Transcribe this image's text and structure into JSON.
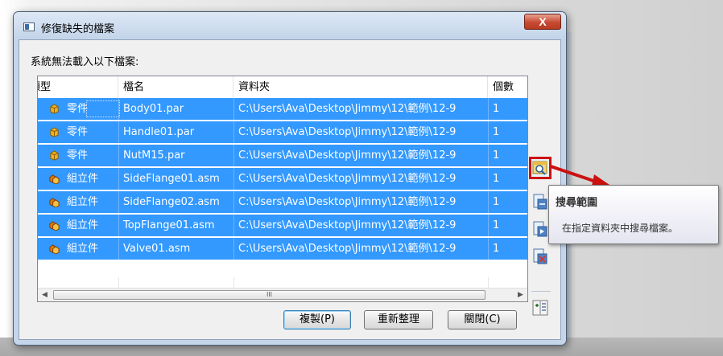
{
  "dialog": {
    "title": "修復缺失的檔案",
    "close_label": "X",
    "prompt": "系統無法載入以下檔案:"
  },
  "table": {
    "headers": [
      "類型",
      "檔名",
      "資料夾",
      "個數"
    ],
    "rows": [
      {
        "type": "零件",
        "type_icon": "part-icon",
        "name": "Body01.par",
        "folder": "C:\\Users\\Ava\\Desktop\\Jimmy\\12\\範例\\12-9",
        "count": "1"
      },
      {
        "type": "零件",
        "type_icon": "part-icon",
        "name": "Handle01.par",
        "folder": "C:\\Users\\Ava\\Desktop\\Jimmy\\12\\範例\\12-9",
        "count": "1"
      },
      {
        "type": "零件",
        "type_icon": "part-icon",
        "name": "NutM15.par",
        "folder": "C:\\Users\\Ava\\Desktop\\Jimmy\\12\\範例\\12-9",
        "count": "1"
      },
      {
        "type": "組立件",
        "type_icon": "assembly-icon",
        "name": "SideFlange01.asm",
        "folder": "C:\\Users\\Ava\\Desktop\\Jimmy\\12\\範例\\12-9",
        "count": "1"
      },
      {
        "type": "組立件",
        "type_icon": "assembly-icon",
        "name": "SideFlange02.asm",
        "folder": "C:\\Users\\Ava\\Desktop\\Jimmy\\12\\範例\\12-9",
        "count": "1"
      },
      {
        "type": "組立件",
        "type_icon": "assembly-icon",
        "name": "TopFlange01.asm",
        "folder": "C:\\Users\\Ava\\Desktop\\Jimmy\\12\\範例\\12-9",
        "count": "1"
      },
      {
        "type": "組立件",
        "type_icon": "assembly-icon",
        "name": "Valve01.asm",
        "folder": "C:\\Users\\Ava\\Desktop\\Jimmy\\12\\範例\\12-9",
        "count": "1"
      }
    ],
    "scroll_thumb_label": "III"
  },
  "buttons": {
    "copy": "複製(P)",
    "refresh": "重新整理",
    "close": "關閉(C)"
  },
  "toolbar": {
    "icons": [
      "search-scope-icon",
      "replace-file-icon",
      "browse-file-icon",
      "remove-file-icon",
      "column-settings-icon"
    ]
  },
  "tooltip": {
    "title": "搜尋範圍",
    "body": "在指定資料夾中搜尋檔案。"
  },
  "colors": {
    "selection": "#3399ff",
    "annotation_red": "#cc1111",
    "part_icon": "#f0b020",
    "assembly_icon": "#e07a10"
  }
}
